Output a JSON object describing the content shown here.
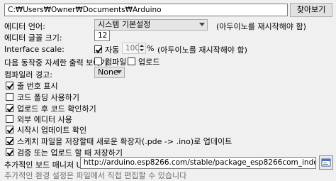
{
  "sketchbook": {
    "path": "C:₩Users₩Owner₩Documents₩Arduino",
    "browse_label": "찾아보기"
  },
  "editor_language": {
    "label": "에디터 언어:",
    "value": "시스템 기본설정",
    "note": "(아두이노를 재시작해야 함)"
  },
  "editor_font_size": {
    "label": "에디터 글꼴 크기:",
    "value": "12"
  },
  "interface_scale": {
    "label": "Interface scale:",
    "auto_label": "자동",
    "auto_checked": true,
    "value": "100",
    "unit": "%",
    "note": "(아두이노를 재시작해야 함)"
  },
  "verbose": {
    "label": "다음 동작중 자세한 출력 보이기:",
    "compile_label": "컴파일",
    "compile_checked": false,
    "upload_label": "업로드",
    "upload_checked": false
  },
  "compiler_warnings": {
    "label": "컴파일러 경고:",
    "value": "None"
  },
  "options": [
    {
      "label": "줄 번호 표시",
      "checked": true
    },
    {
      "label": "코드 폴딩 사용하기",
      "checked": false
    },
    {
      "label": "업로드 후 코드 확인하기",
      "checked": true
    },
    {
      "label": "외부 에디터 사용",
      "checked": false
    },
    {
      "label": "시작시 업데이트 확인",
      "checked": true
    },
    {
      "label": "스케치 파일을 저장할때 새로운 확장자(.pde -> .ino)로 업데이트",
      "checked": true
    },
    {
      "label": "검증 또는 업로드 할 때 저장하기",
      "checked": true
    }
  ],
  "board_manager": {
    "label": "추가적인 보드 매니저 URLs",
    "value": "http://arduino.esp8266.com/stable/package_esp8266com_index.json"
  },
  "footer_note": "추가적인 환경 설정은 파일에서 직접 편집할 수 있습니다"
}
